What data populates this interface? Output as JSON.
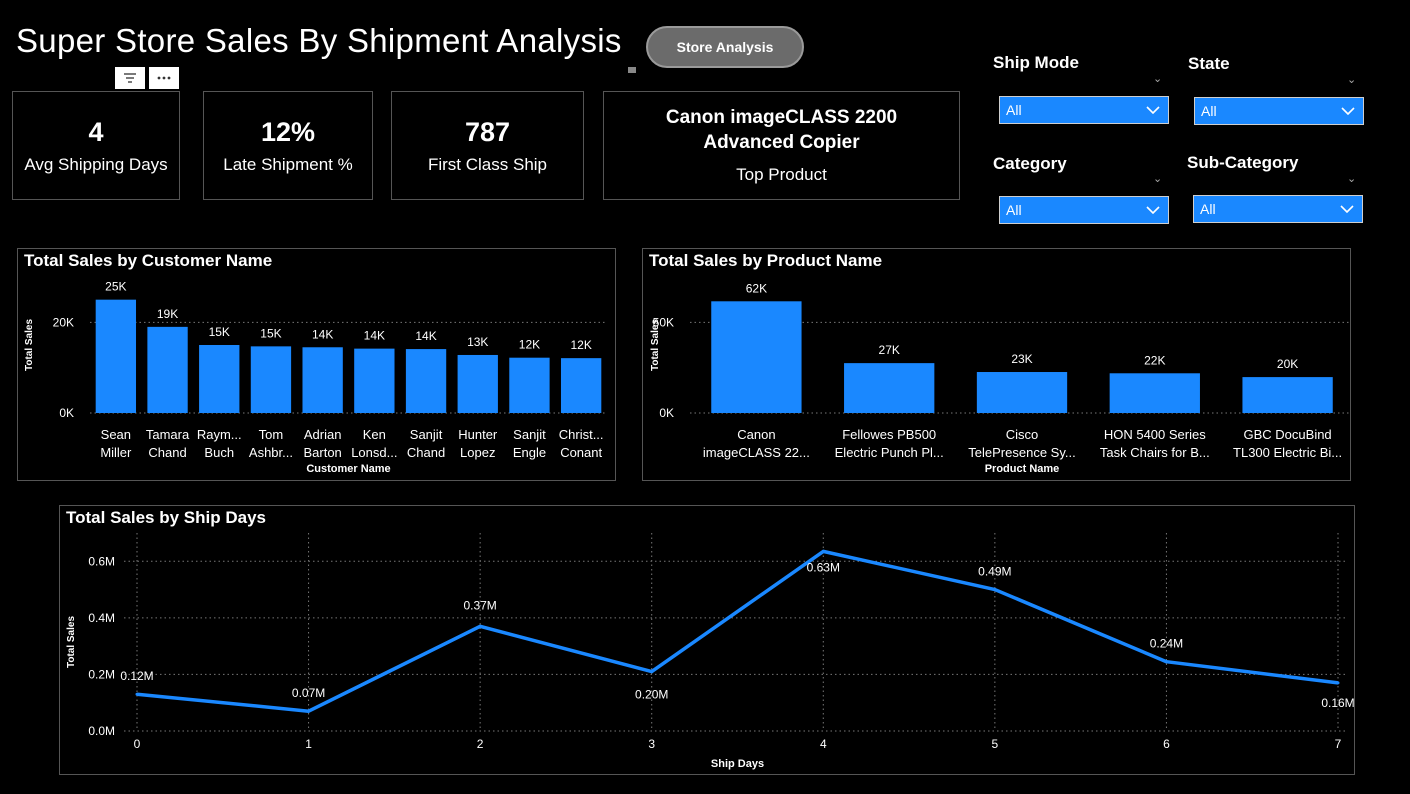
{
  "header": {
    "title": "Super Store Sales By Shipment Analysis",
    "nav_button": "Store Analysis",
    "visual_icons": {
      "filter": "filter-icon",
      "more": "more-options-icon"
    }
  },
  "kpis": [
    {
      "value": "4",
      "label": "Avg Shipping Days"
    },
    {
      "value": "12%",
      "label": "Late Shipment %"
    },
    {
      "value": "787",
      "label": "First Class Ship"
    }
  ],
  "top_product": {
    "value_line1": "Canon imageCLASS 2200",
    "value_line2": "Advanced Copier",
    "label": "Top Product"
  },
  "slicers": [
    {
      "title": "Ship Mode",
      "value": "All"
    },
    {
      "title": "State",
      "value": "All"
    },
    {
      "title": "Category",
      "value": "All"
    },
    {
      "title": "Sub-Category",
      "value": "All"
    }
  ],
  "colors": {
    "accent": "#1a88ff",
    "background": "#000000",
    "border": "#555555"
  },
  "chart_data": [
    {
      "id": "customer",
      "type": "bar",
      "title": "Total Sales by Customer Name",
      "xlabel": "Customer Name",
      "ylabel": "Total Sales",
      "ylim": [
        0,
        30000
      ],
      "yticks": [
        {
          "value": 0,
          "label": "0K"
        },
        {
          "value": 20000,
          "label": "20K"
        }
      ],
      "categories": [
        [
          "Sean",
          "Miller"
        ],
        [
          "Tamara",
          "Chand"
        ],
        [
          "Raym...",
          "Buch"
        ],
        [
          "Tom",
          "Ashbr..."
        ],
        [
          "Adrian",
          "Barton"
        ],
        [
          "Ken",
          "Lonsd..."
        ],
        [
          "Sanjit",
          "Chand"
        ],
        [
          "Hunter",
          "Lopez"
        ],
        [
          "Sanjit",
          "Engle"
        ],
        [
          "Christ...",
          "Conant"
        ]
      ],
      "values": [
        25000,
        19000,
        15000,
        14700,
        14500,
        14200,
        14100,
        12800,
        12200,
        12100
      ],
      "data_labels": [
        "25K",
        "19K",
        "15K",
        "15K",
        "14K",
        "14K",
        "14K",
        "13K",
        "12K",
        "12K"
      ],
      "grid": true
    },
    {
      "id": "product",
      "type": "bar",
      "title": "Total Sales by Product Name",
      "xlabel": "Product Name",
      "ylabel": "Total Sales",
      "ylim": [
        0,
        75000
      ],
      "yticks": [
        {
          "value": 0,
          "label": "0K"
        },
        {
          "value": 50000,
          "label": "50K"
        }
      ],
      "categories": [
        [
          "Canon",
          "imageCLASS 22..."
        ],
        [
          "Fellowes PB500",
          "Electric Punch Pl..."
        ],
        [
          "Cisco",
          "TelePresence Sy..."
        ],
        [
          "HON 5400 Series",
          "Task Chairs for B..."
        ],
        [
          "GBC DocuBind",
          "TL300 Electric Bi..."
        ]
      ],
      "values": [
        61600,
        27500,
        22600,
        21900,
        19800
      ],
      "data_labels": [
        "62K",
        "27K",
        "23K",
        "22K",
        "20K"
      ],
      "grid": true
    },
    {
      "id": "shipdays",
      "type": "line",
      "title": "Total Sales by Ship Days",
      "xlabel": "Ship Days",
      "ylabel": "Total Sales",
      "x": [
        0,
        1,
        2,
        3,
        4,
        5,
        6,
        7
      ],
      "values": [
        0.13,
        0.07,
        0.37,
        0.21,
        0.635,
        0.5,
        0.245,
        0.17
      ],
      "data_labels": [
        "0.12M",
        "0.07M",
        "0.37M",
        "0.20M",
        "0.63M",
        "0.49M",
        "0.24M",
        "0.16M"
      ],
      "ylim": [
        0,
        0.7
      ],
      "yticks": [
        {
          "value": 0,
          "label": "0.0M"
        },
        {
          "value": 0.2,
          "label": "0.2M"
        },
        {
          "value": 0.4,
          "label": "0.4M"
        },
        {
          "value": 0.6,
          "label": "0.6M"
        }
      ],
      "grid": true
    }
  ]
}
